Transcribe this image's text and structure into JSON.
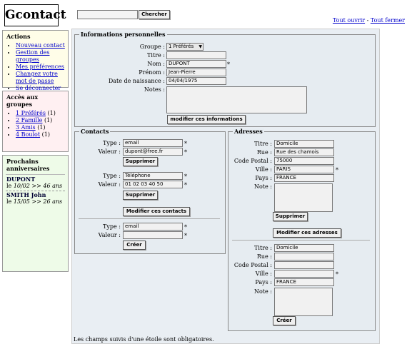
{
  "app": {
    "logo": "Gcontact"
  },
  "search": {
    "value": "",
    "button": "Chercher"
  },
  "toplinks": {
    "open": "Tout ouvrir",
    "sep": " - ",
    "close": "Tout fermer"
  },
  "actions": {
    "title": "Actions",
    "items": [
      "Nouveau contact",
      "Gestion des groupes",
      "Mes préférences",
      "Changez votre mot de passe",
      "Se déconnecter"
    ]
  },
  "groups": {
    "title": "Accès aux groupes",
    "items": [
      {
        "label": "1 Préférés",
        "count": "(1)"
      },
      {
        "label": "2 Famille",
        "count": "(1)"
      },
      {
        "label": "3 Amis",
        "count": "(1)"
      },
      {
        "label": "4 Boulot",
        "count": "(1)"
      }
    ]
  },
  "birthdays": {
    "title": "Prochains anniversaires",
    "items": [
      {
        "name": "DUPONT",
        "prefix": "le ",
        "date": "10/02",
        "sep": " >> ",
        "age": "46 ans"
      },
      {
        "name": "SMITH John",
        "prefix": "le ",
        "date": "15/05",
        "sep": " >> ",
        "age": "26 ans"
      }
    ]
  },
  "personal": {
    "legend": "Informations personnelles",
    "group_label": "Groupe :",
    "group_value": "1 Préférés",
    "title_label": "Titre :",
    "title_value": "",
    "name_label": "Nom :",
    "name_value": "DUPONT",
    "firstname_label": "Prénom :",
    "firstname_value": "Jean-Pierre",
    "birth_label": "Date de naissance :",
    "birth_value": "04/04/1975",
    "notes_label": "Notes :",
    "submit": "modifier ces informations",
    "star": "*"
  },
  "contacts": {
    "legend": "Contacts",
    "type_label": "Type :",
    "value_label": "Valeur :",
    "c1_type": "email",
    "c1_value": "dupont@free.fr",
    "c2_type": "Téléphone",
    "c2_value": "01 02 03 40 50",
    "delete": "Supprimer",
    "modify": "Modifier ces contacts",
    "new_type": "email",
    "new_value": "",
    "create": "Créer",
    "star": "*"
  },
  "addresses": {
    "legend": "Adresses",
    "title_label": "Titre :",
    "street_label": "Rue :",
    "zip_label": "Code Postal :",
    "city_label": "Ville :",
    "country_label": "Pays :",
    "note_label": "Note :",
    "a1_title": "Domicile",
    "a1_street": "Rue des chamois",
    "a1_zip": "75000",
    "a1_city": "PARIS",
    "a1_country": "FRANCE",
    "delete": "Supprimer",
    "modify": "Modifier ces adresses",
    "new_title": "Domicile",
    "new_street": "",
    "new_zip": "",
    "new_city": "",
    "new_country": "FRANCE",
    "create": "Créer",
    "star": "*"
  },
  "footer": {
    "note": "Les champs suivis d'une étoile sont obligatoires."
  }
}
